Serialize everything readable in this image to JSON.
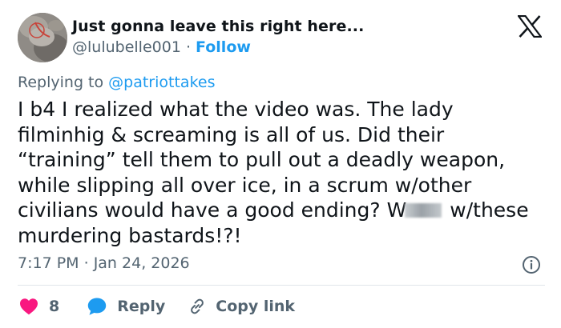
{
  "author": {
    "display_name": "Just gonna leave this right here...",
    "handle": "@lulubelle001",
    "separator": " · ",
    "follow_label": "Follow",
    "avatar_icon": "avatar-photo",
    "brand_logo_icon": "x-logo-icon"
  },
  "reply_context": {
    "prefix": "Replying to ",
    "mention": "@patriottakes"
  },
  "tweet": {
    "text_before_blur": "I b4 I realized what the video was. The lady filminhig & screaming is all of us. Did their “training” tell them to pull out a deadly weapon, while slipping all over ice, in a scrum w/other civilians would have a good ending? W",
    "text_after_blur": " w/these murdering bastards!?!"
  },
  "meta": {
    "time": "7:17 PM",
    "separator": " · ",
    "date": "Jan 24, 2026",
    "info_icon": "info-icon"
  },
  "actions": {
    "likes_count": "8",
    "reply_label": "Reply",
    "copy_link_label": "Copy link"
  },
  "colors": {
    "accent": "#1d9bf0",
    "like": "#f91880",
    "text": "#0f1419",
    "muted": "#536471",
    "divider": "#e1e6ea"
  }
}
